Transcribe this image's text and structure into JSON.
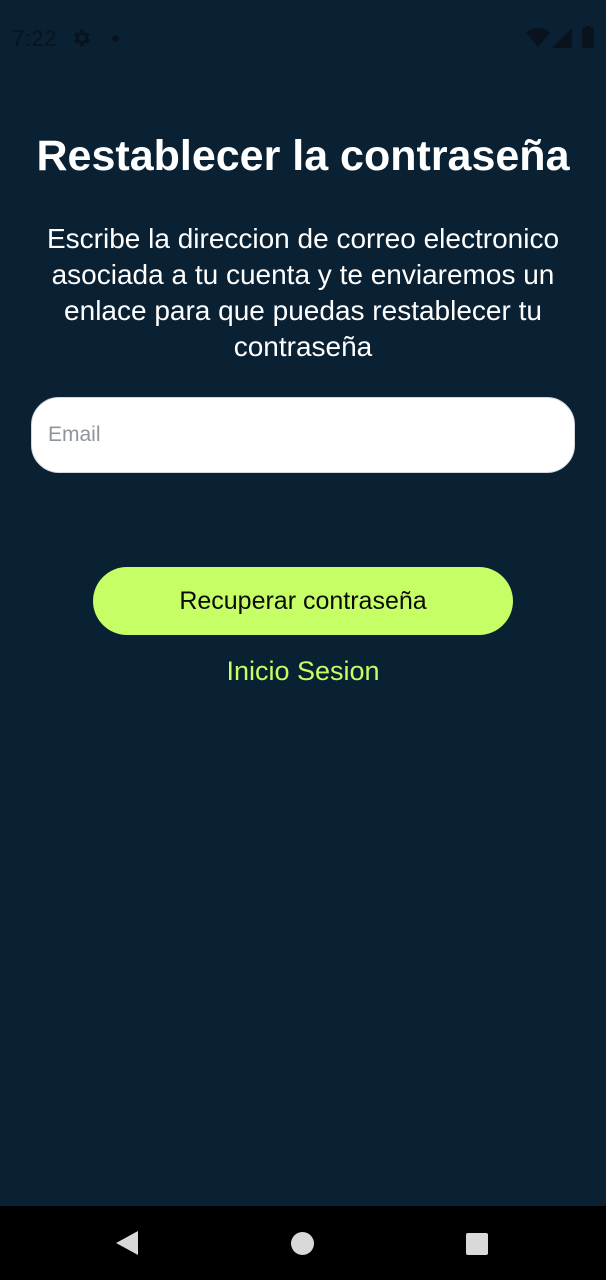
{
  "status_bar": {
    "time": "7:22",
    "icons": [
      "gear-icon",
      "notification-dot-icon",
      "wifi-icon",
      "signal-icon",
      "battery-icon"
    ]
  },
  "screen": {
    "title": "Restablecer la contraseña",
    "description": "Escribe la direccion de correo electronico asociada a tu cuenta y te enviaremos un enlace para que puedas restablecer tu contraseña"
  },
  "form": {
    "email_placeholder": "Email",
    "email_value": "",
    "submit_label": "Recuperar contraseña",
    "login_link_label": "Inicio Sesion"
  },
  "nav_bar": {
    "icons": [
      "back-icon",
      "home-icon",
      "recents-icon"
    ]
  },
  "colors": {
    "background": "#0a2033",
    "accent": "#c6fe66",
    "text": "#ffffff",
    "navbar": "#000000"
  }
}
